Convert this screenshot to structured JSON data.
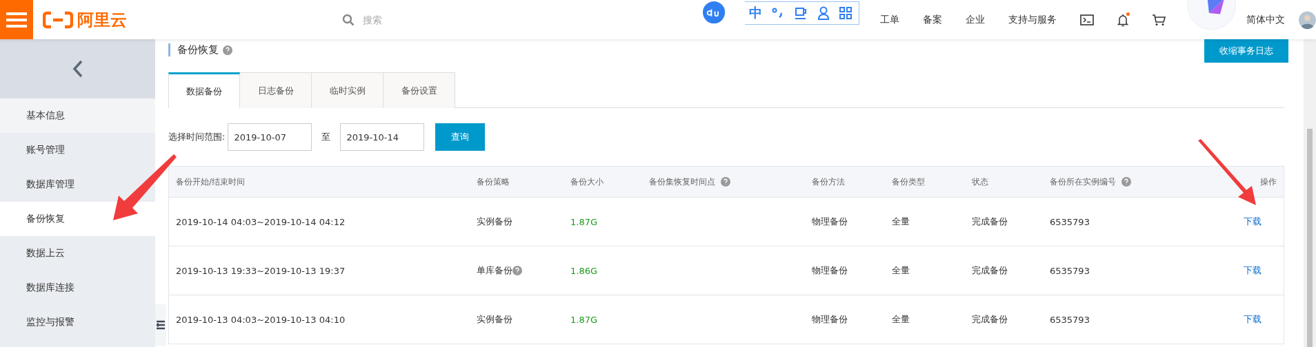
{
  "header": {
    "logo_text": "阿里云",
    "search_placeholder": "搜索",
    "ime_label": "中",
    "nav": [
      "工单",
      "备案",
      "企业",
      "支持与服务"
    ],
    "has_notification": true,
    "language": "简体中文"
  },
  "sidebar": {
    "items": [
      {
        "label": "基本信息",
        "selected": false
      },
      {
        "label": "账号管理",
        "selected": false
      },
      {
        "label": "数据库管理",
        "selected": false
      },
      {
        "label": "备份恢复",
        "selected": true
      },
      {
        "label": "数据上云",
        "selected": false
      },
      {
        "label": "数据库连接",
        "selected": false
      },
      {
        "label": "监控与报警",
        "selected": false
      }
    ]
  },
  "page": {
    "title": "备份恢复",
    "action_button": "收缩事务日志"
  },
  "tabs": [
    {
      "label": "数据备份",
      "selected": true
    },
    {
      "label": "日志备份",
      "selected": false
    },
    {
      "label": "临时实例",
      "selected": false
    },
    {
      "label": "备份设置",
      "selected": false
    }
  ],
  "filter": {
    "label": "选择时间范围:",
    "start": "2019-10-07",
    "separator": "至",
    "end": "2019-10-14",
    "button": "查询"
  },
  "table": {
    "columns": [
      {
        "label": "备份开始/结束时间",
        "help": false
      },
      {
        "label": "备份策略",
        "help": false
      },
      {
        "label": "备份大小",
        "help": false
      },
      {
        "label": "备份集恢复时间点",
        "help": true
      },
      {
        "label": "备份方法",
        "help": false
      },
      {
        "label": "备份类型",
        "help": false
      },
      {
        "label": "状态",
        "help": false
      },
      {
        "label": "备份所在实例编号",
        "help": true
      },
      {
        "label": "操作",
        "help": false
      }
    ],
    "rows": [
      {
        "time": "2019-10-14 04:03~2019-10-14 04:12",
        "strategy": "实例备份",
        "strategy_help": false,
        "size": "1.87G",
        "method": "物理备份",
        "type": "全量",
        "status": "完成备份",
        "instance": "6535793",
        "action": "下载"
      },
      {
        "time": "2019-10-13 19:33~2019-10-13 19:37",
        "strategy": "单库备份",
        "strategy_help": true,
        "size": "1.86G",
        "method": "物理备份",
        "type": "全量",
        "status": "完成备份",
        "instance": "6535793",
        "action": "下载"
      },
      {
        "time": "2019-10-13 04:03~2019-10-13 04:10",
        "strategy": "实例备份",
        "strategy_help": false,
        "size": "1.87G",
        "method": "物理备份",
        "type": "全量",
        "status": "完成备份",
        "instance": "6535793",
        "action": "下载"
      }
    ]
  }
}
